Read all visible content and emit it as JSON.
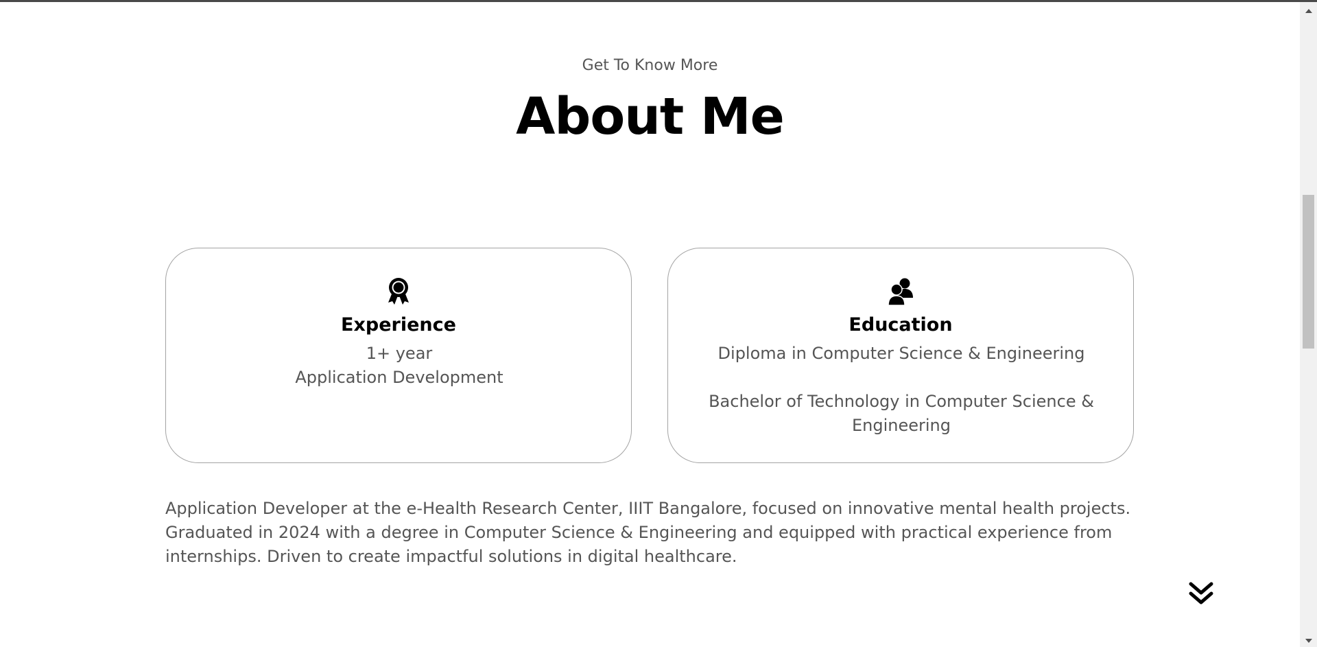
{
  "about": {
    "subtitle": "Get To Know More",
    "title": "About Me"
  },
  "cards": {
    "experience": {
      "icon": "award-icon",
      "title": "Experience",
      "lines": [
        "1+ year",
        "Application Development"
      ]
    },
    "education": {
      "icon": "users-icon",
      "title": "Education",
      "lines": [
        "Diploma in Computer Science & Engineering",
        "Bachelor of Technology in Computer Science & Engineering"
      ]
    }
  },
  "description": "Application Developer at the e-Health Research Center, IIIT Bangalore, focused on innovative mental health projects. Graduated in 2024 with a degree in Computer Science & Engineering and equipped with practical experience from internships. Driven to create impactful solutions in digital healthcare.",
  "scroll_arrow": {
    "icon": "double-chevron-down-icon"
  },
  "colors": {
    "text_primary": "#000000",
    "text_secondary": "#555555",
    "card_border": "#a3a3a3"
  }
}
